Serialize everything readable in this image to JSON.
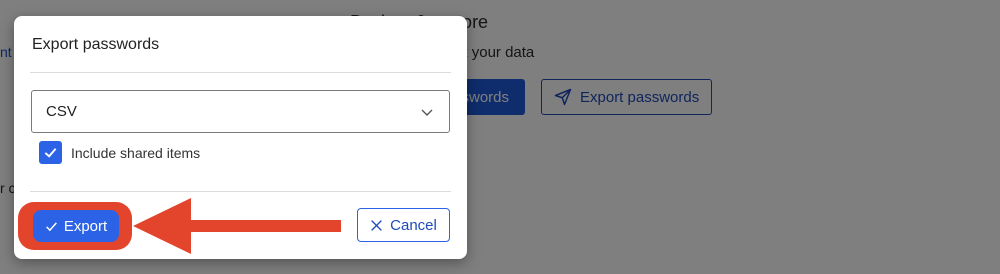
{
  "background": {
    "title": "Backup & restore",
    "subtitle": "Back up or export your data",
    "left_link": "nt",
    "left_text": "r c",
    "primary_button_label": "passwords",
    "export_button_label": "Export passwords",
    "export_button_icon": "send-icon"
  },
  "dialog": {
    "title": "Export passwords",
    "format_select": {
      "value": "CSV",
      "icon": "chevron-down-icon"
    },
    "include_shared": {
      "label": "Include shared items",
      "checked": true
    },
    "export_button": {
      "label": "Export",
      "icon": "check-icon"
    },
    "cancel_button": {
      "label": "Cancel",
      "icon": "close-icon"
    }
  },
  "colors": {
    "primary": "#2c63e6",
    "highlight": "#e2452c",
    "overlay": "rgba(0,0,0,0.5)"
  }
}
